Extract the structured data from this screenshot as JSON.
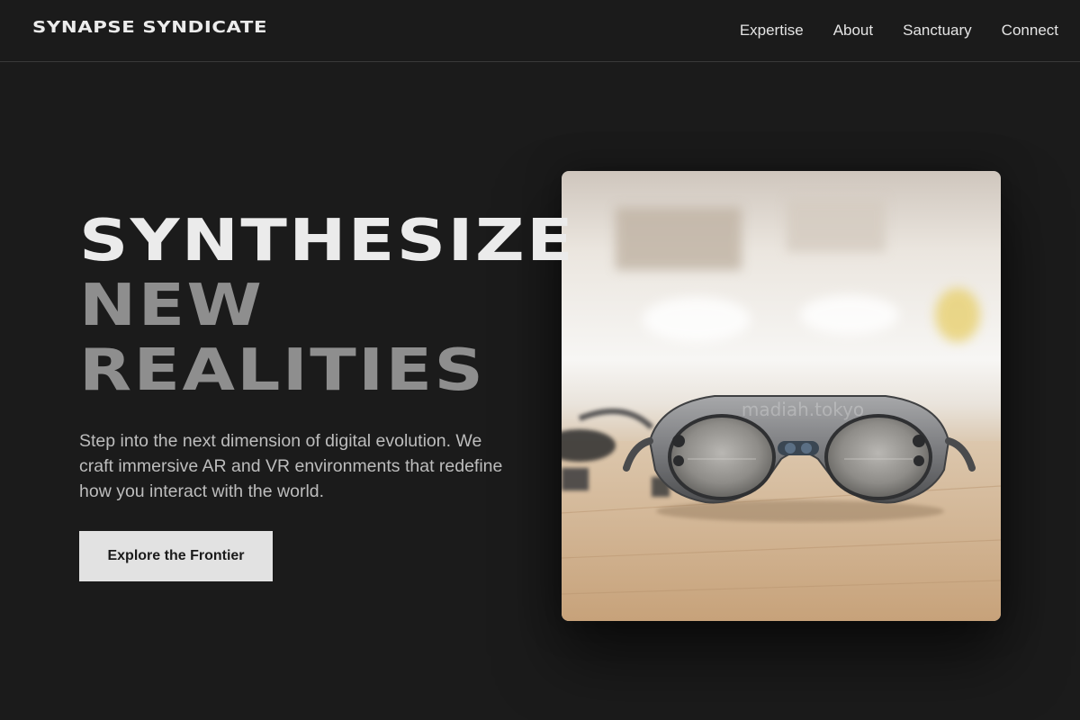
{
  "header": {
    "brand": "SYNAPSE SYNDICATE",
    "nav": [
      "Expertise",
      "About",
      "Sanctuary",
      "Connect"
    ]
  },
  "hero": {
    "heading_lines": [
      "SYNTHESIZE",
      "NEW",
      "REALITIES"
    ],
    "subtitle": "Step into the next dimension of digital evolution. We craft immersive AR and VR environments that redefine how you interact with the world.",
    "cta_label": "Explore the Frontier",
    "image_watermark": "madiah.tokyo"
  },
  "colors": {
    "background": "#1b1b1b",
    "heading_primary": "#ebebeb",
    "heading_muted": "#8e8e8e",
    "cta_background": "#e2e2e2"
  }
}
